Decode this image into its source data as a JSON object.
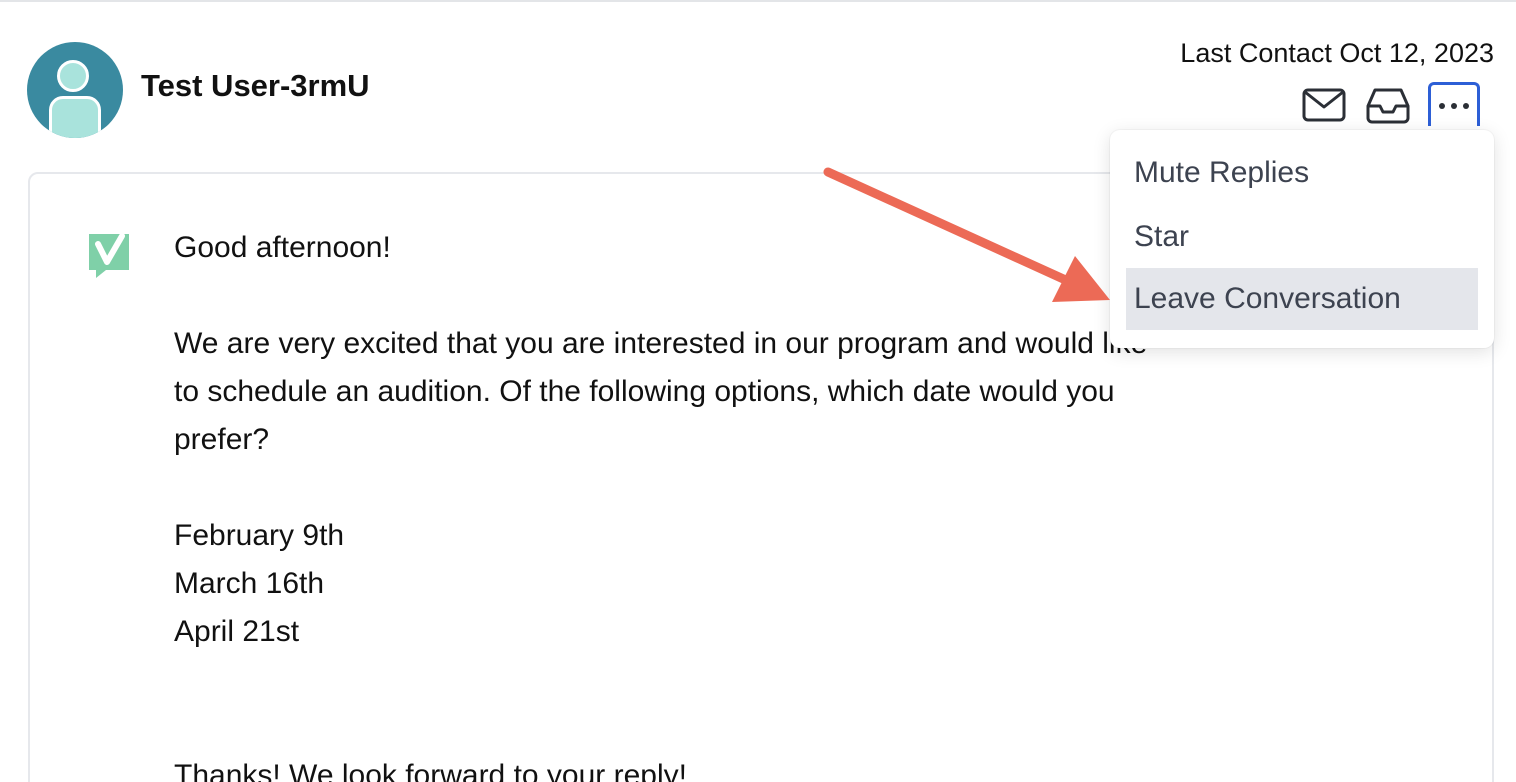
{
  "contact": {
    "name": "Test User-3rmU",
    "last_contact": "Last Contact Oct 12, 2023"
  },
  "icons": {
    "avatar": "user-avatar-icon",
    "mail": "envelope-icon",
    "inbox": "inbox-tray-icon",
    "more": "ellipsis-icon",
    "brand": "checkmark-logo-icon"
  },
  "menu": {
    "items": [
      {
        "label": "Mute Replies"
      },
      {
        "label": "Star"
      },
      {
        "label": "Leave Conversation"
      }
    ],
    "highlighted": "Leave Conversation"
  },
  "message": {
    "greeting": "Good afternoon!",
    "body_line1": "We are very excited that you are interested in our program and would like",
    "body_line2": "to schedule an audition. Of the following options, which date would you",
    "body_line3": "prefer?",
    "options": [
      "February 9th",
      "March 16th",
      "April 21st"
    ],
    "closing": "Thanks! We look forward to your reply!"
  },
  "colors": {
    "avatar_bg": "#3a8aa0",
    "avatar_fg": "#a9e3dc",
    "accent_border": "#2d5fd6",
    "brand_green": "#5ec08e",
    "annotation_arrow": "#ec6a56",
    "menu_highlight": "#e4e6eb"
  }
}
